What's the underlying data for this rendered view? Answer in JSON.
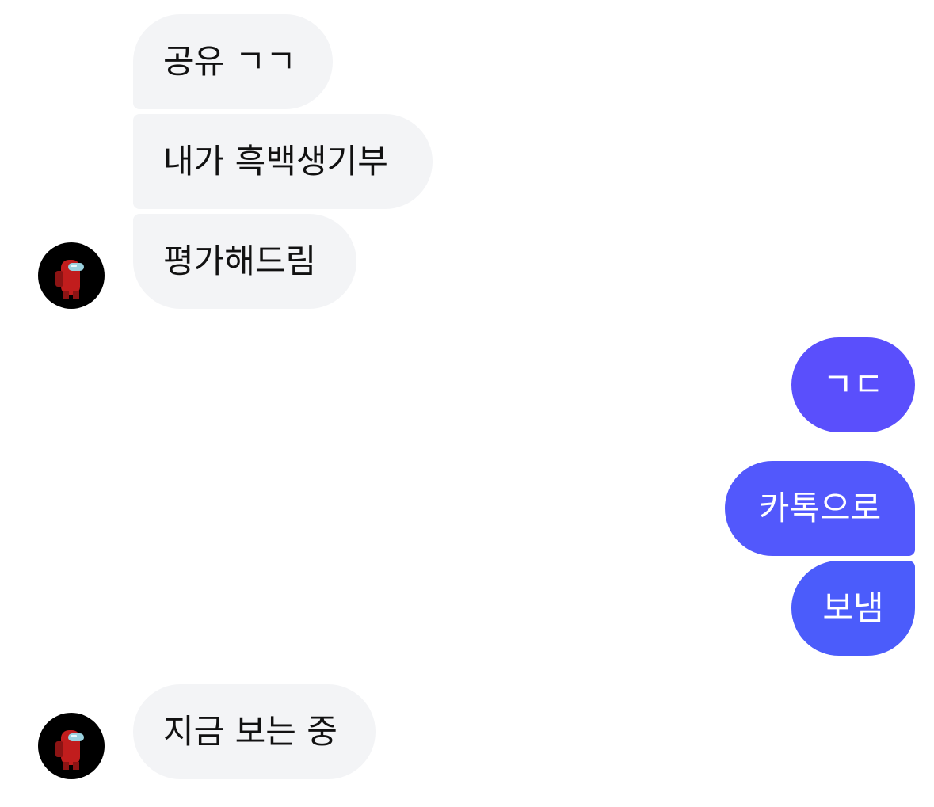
{
  "chat": {
    "incoming_group_1": [
      {
        "text": "공유 ㄱㄱ"
      },
      {
        "text": "내가 흑백생기부"
      },
      {
        "text": "평가해드림"
      }
    ],
    "outgoing_1": [
      {
        "text": "ㄱㄷ"
      }
    ],
    "outgoing_group_2": [
      {
        "text": "카톡으로"
      },
      {
        "text": "보냄"
      }
    ],
    "incoming_group_2": [
      {
        "text": "지금 보는 중"
      }
    ]
  },
  "avatar": {
    "icon": "among-us-red-crewmate-icon"
  },
  "colors": {
    "incoming_bubble": "#f3f4f6",
    "outgoing_top": "#5a4ffc",
    "outgoing_bottom": "#4b5cfb",
    "avatar_bg": "#000000",
    "crewmate_red": "#c11d1d",
    "visor": "#9ad1de"
  }
}
